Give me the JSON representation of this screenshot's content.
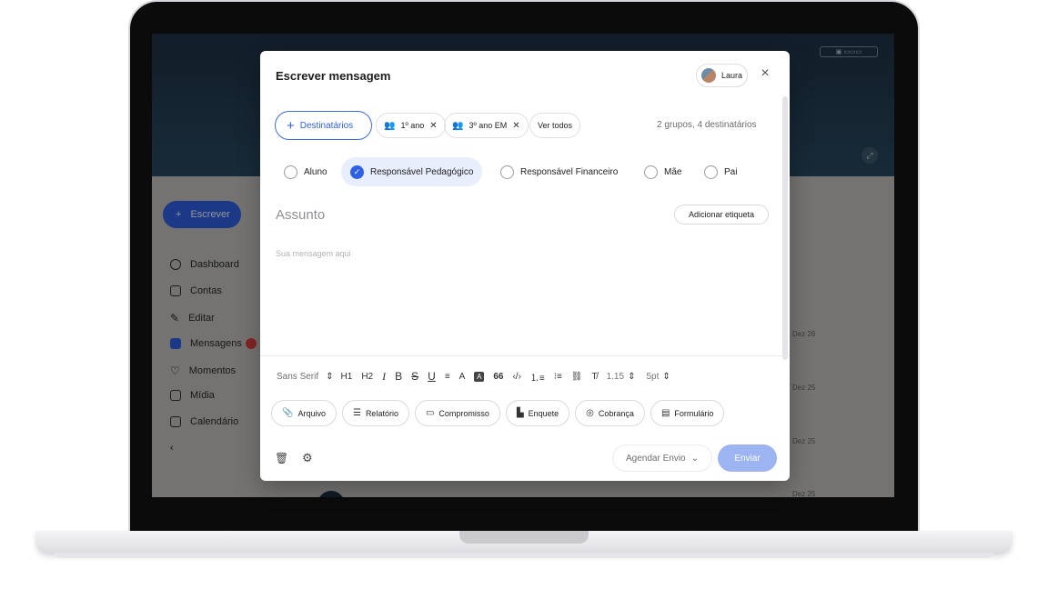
{
  "background_app": {
    "write_button": "Escrever",
    "sidebar": [
      {
        "icon": "dashboard-icon",
        "label": "Dashboard"
      },
      {
        "icon": "accounts-icon",
        "label": "Contas"
      },
      {
        "icon": "pencil-icon",
        "label": "Editar"
      },
      {
        "icon": "mail-icon",
        "label": "Mensagens"
      },
      {
        "icon": "heart-icon",
        "label": "Momentos"
      },
      {
        "icon": "image-icon",
        "label": "Mídia"
      },
      {
        "icon": "calendar-icon",
        "label": "Calendário"
      }
    ],
    "list_dates": [
      "Dez 26",
      "Dez 25",
      "Dez 25",
      "Dez 25"
    ]
  },
  "modal": {
    "title": "Escrever mensagem",
    "user_name": "Laura",
    "recipients_button": "Destinatários",
    "groups": [
      {
        "label": "1º ano"
      },
      {
        "label": "3º ano EM"
      }
    ],
    "see_all": "Ver todos",
    "summary": "2 grupos, 4 destinatários",
    "roles": [
      {
        "label": "Aluno",
        "selected": false
      },
      {
        "label": "Responsável Pedagógico",
        "selected": true
      },
      {
        "label": "Responsável Financeiro",
        "selected": false
      },
      {
        "label": "Mãe",
        "selected": false
      },
      {
        "label": "Pai",
        "selected": false
      }
    ],
    "subject_placeholder": "Assunto",
    "add_tag": "Adicionar etiqueta",
    "message_placeholder": "Sua mensagem aqui",
    "toolbar": {
      "font": "Sans Serif",
      "h1": "H1",
      "h2": "H2",
      "italic": "I",
      "bold": "B",
      "strike": "S",
      "underline": "U",
      "quote": "66",
      "line_height": "1.15",
      "font_size": "5pt"
    },
    "attachments": [
      {
        "icon": "paperclip-icon",
        "label": "Arquivo"
      },
      {
        "icon": "list-icon",
        "label": "Relatório"
      },
      {
        "icon": "calendar-icon",
        "label": "Compromisso"
      },
      {
        "icon": "poll-icon",
        "label": "Enquete"
      },
      {
        "icon": "payment-icon",
        "label": "Cobrança"
      },
      {
        "icon": "form-icon",
        "label": "Formulário"
      }
    ],
    "schedule_button": "Agendar Envio",
    "send_button": "Enviar"
  },
  "colors": {
    "primary": "#2d61e6",
    "send_disabled": "#9db4f3",
    "selected_role_bg": "#e8eefc"
  }
}
